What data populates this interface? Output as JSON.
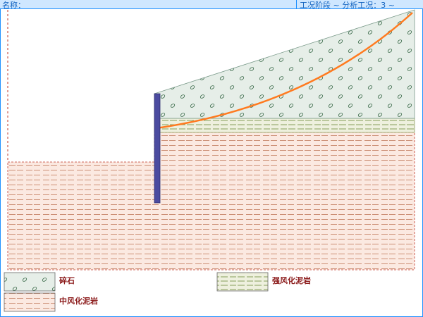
{
  "header": {
    "name_label": "名称：",
    "condition_label": "工况阶段 ~ 分析工况：3 ~"
  },
  "legend": {
    "rock_label": "碎石",
    "strong_weathered_label": "强风化泥岩",
    "moderate_weathered_label": "中风化泥岩"
  },
  "colors": {
    "rock_fill": "#e6eee8",
    "strong_fill": "#eef0de",
    "moderate_fill": "#fbe9e1",
    "retaining_wall": "#4b4ba0",
    "slip_surface": "#ff7a1f",
    "frame_blue": "#1e90ff"
  },
  "icons": {
    "slip_surface": "slip-surface-curve",
    "retaining_wall": "retaining-pile"
  }
}
